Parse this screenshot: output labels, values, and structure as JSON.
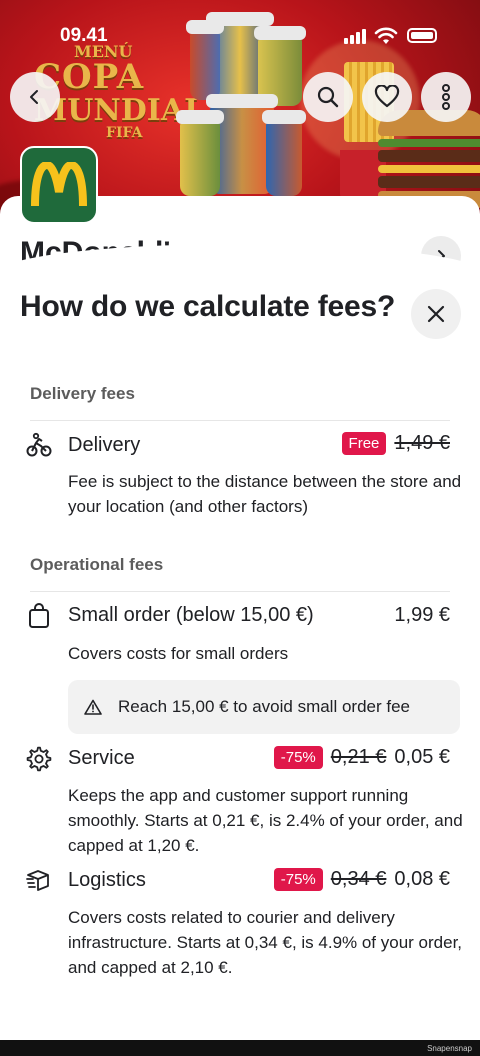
{
  "status_bar": {
    "time": "09.41"
  },
  "hero": {
    "promo_line1": "MENÚ",
    "promo_line2": "COPA",
    "promo_line3": "MUNDIAL",
    "promo_line4": "FIFA"
  },
  "restaurant": {
    "name": "McDonald's"
  },
  "sheet": {
    "title": "How do we calculate fees?",
    "sections": {
      "delivery": {
        "heading": "Delivery fees",
        "label": "Delivery",
        "badge": "Free",
        "old_price": "1,49 €",
        "description": "Fee is subject to the distance between the store and your location (and other factors)"
      },
      "operational": {
        "heading": "Operational fees",
        "small_order": {
          "label": "Small order (below 15,00 €)",
          "price": "1,99 €",
          "description": "Covers costs for small orders",
          "notice": "Reach 15,00 € to avoid small order fee"
        },
        "service": {
          "label": "Service",
          "badge": "-75%",
          "old_price": "0,21 €",
          "price": "0,05 €",
          "description": "Keeps the app and customer support running smoothly. Starts at 0,21 €, is 2.4% of your order, and capped at 1,20 €."
        },
        "logistics": {
          "label": "Logistics",
          "badge": "-75%",
          "old_price": "0,34 €",
          "price": "0,08 €",
          "description": "Covers costs related to courier and delivery infrastructure. Starts at 0,34 €, is 4.9% of your order, and capped at 2,10 €."
        }
      }
    }
  },
  "watermark": "Snapensnap",
  "colors": {
    "badge": "#e0174a",
    "brand_green": "#1f6a3b",
    "brand_yellow": "#f6c21c"
  }
}
